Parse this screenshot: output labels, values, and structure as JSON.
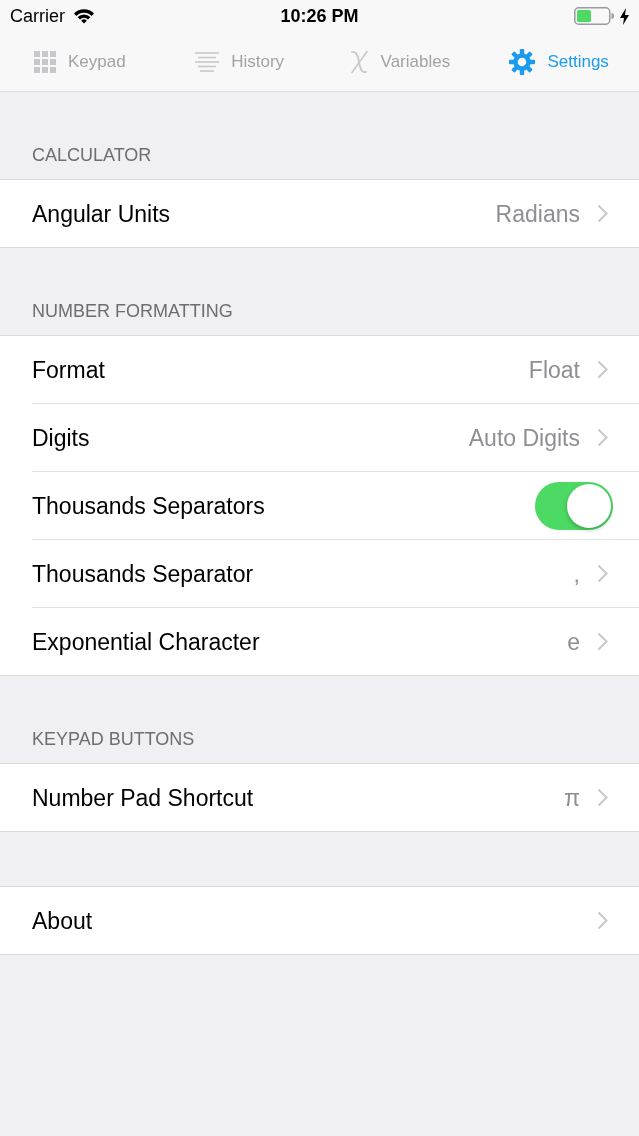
{
  "status_bar": {
    "carrier": "Carrier",
    "time": "10:26 PM"
  },
  "tabs": [
    {
      "kind": "keypad",
      "label": "Keypad",
      "selected": false
    },
    {
      "kind": "history",
      "label": "History",
      "selected": false
    },
    {
      "kind": "variables",
      "label": "Variables",
      "selected": false
    },
    {
      "kind": "settings",
      "label": "Settings",
      "selected": true
    }
  ],
  "sections": [
    {
      "header": "CALCULATOR",
      "rows": [
        {
          "kind": "disclosure",
          "label": "Angular Units",
          "value": "Radians"
        }
      ]
    },
    {
      "header": "NUMBER FORMATTING",
      "rows": [
        {
          "kind": "disclosure",
          "label": "Format",
          "value": "Float"
        },
        {
          "kind": "disclosure",
          "label": "Digits",
          "value": "Auto Digits"
        },
        {
          "kind": "toggle",
          "label": "Thousands Separators",
          "on": true
        },
        {
          "kind": "disclosure",
          "label": "Thousands Separator",
          "value": ","
        },
        {
          "kind": "disclosure",
          "label": "Exponential Character",
          "value": "e"
        }
      ]
    },
    {
      "header": "KEYPAD BUTTONS",
      "rows": [
        {
          "kind": "disclosure",
          "label": "Number Pad Shortcut",
          "value": "π"
        }
      ]
    },
    {
      "rows": [
        {
          "kind": "disclosure",
          "label": "About"
        }
      ]
    }
  ]
}
